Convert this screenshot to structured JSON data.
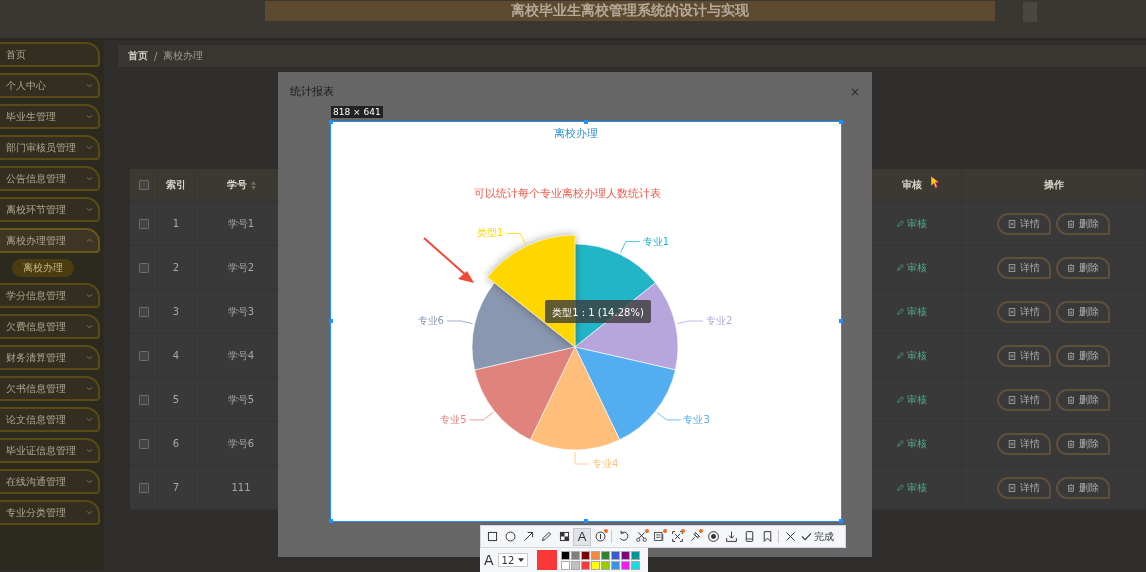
{
  "header": {
    "title": "离校毕业生离校管理系统的设计与实现"
  },
  "sidebar": {
    "items": [
      {
        "label": "首页",
        "has_children": false,
        "expanded": false
      },
      {
        "label": "个人中心",
        "has_children": true,
        "expanded": false
      },
      {
        "label": "毕业生管理",
        "has_children": true,
        "expanded": false
      },
      {
        "label": "部门审核员管理",
        "has_children": true,
        "expanded": false
      },
      {
        "label": "公告信息管理",
        "has_children": true,
        "expanded": false
      },
      {
        "label": "离校环节管理",
        "has_children": true,
        "expanded": false
      },
      {
        "label": "离校办理管理",
        "has_children": true,
        "expanded": true,
        "children": [
          {
            "label": "离校办理",
            "selected": true
          }
        ]
      },
      {
        "label": "学分信息管理",
        "has_children": true,
        "expanded": false
      },
      {
        "label": "欠费信息管理",
        "has_children": true,
        "expanded": false
      },
      {
        "label": "财务清算管理",
        "has_children": true,
        "expanded": false
      },
      {
        "label": "欠书信息管理",
        "has_children": true,
        "expanded": false
      },
      {
        "label": "论文信息管理",
        "has_children": true,
        "expanded": false
      },
      {
        "label": "毕业证信息管理",
        "has_children": true,
        "expanded": false
      },
      {
        "label": "在线沟通管理",
        "has_children": true,
        "expanded": false
      },
      {
        "label": "专业分类管理",
        "has_children": true,
        "expanded": false
      }
    ]
  },
  "breadcrumb": {
    "items": [
      "首页",
      "离校办理"
    ],
    "separator": "/"
  },
  "table": {
    "all_checked": false,
    "columns": [
      "索引",
      "学号",
      "审核",
      "操作"
    ],
    "rows": [
      {
        "checked": false,
        "index": "1",
        "student_id": "学号1",
        "audit": "审核",
        "actions": [
          "详情",
          "删除"
        ]
      },
      {
        "checked": false,
        "index": "2",
        "student_id": "学号2",
        "audit": "审核",
        "actions": [
          "详情",
          "删除"
        ]
      },
      {
        "checked": false,
        "index": "3",
        "student_id": "学号3",
        "audit": "审核",
        "actions": [
          "详情",
          "删除"
        ]
      },
      {
        "checked": false,
        "index": "4",
        "student_id": "学号4",
        "audit": "审核",
        "actions": [
          "详情",
          "删除"
        ]
      },
      {
        "checked": false,
        "index": "5",
        "student_id": "学号5",
        "audit": "审核",
        "actions": [
          "详情",
          "删除"
        ]
      },
      {
        "checked": false,
        "index": "6",
        "student_id": "学号6",
        "audit": "审核",
        "actions": [
          "详情",
          "删除"
        ]
      },
      {
        "checked": false,
        "index": "7",
        "student_id": "111",
        "audit": "审核",
        "actions": [
          "详情",
          "删除"
        ]
      }
    ]
  },
  "dialog": {
    "title": "统计报表",
    "close": "×"
  },
  "capture": {
    "size": "818 × 641",
    "heading": "离校办理",
    "tooltip": "类型1 : 1 (14.28%)",
    "slices": [
      {
        "hovered": false
      },
      {
        "hovered": false
      },
      {
        "hovered": false
      },
      {
        "hovered": false
      },
      {
        "hovered": false
      },
      {
        "hovered": false
      },
      {
        "hovered": true
      }
    ],
    "chart_data": {
      "type": "pie",
      "title": "可以统计每个专业离校办理人数统计表",
      "categories": [
        "专业1",
        "专业2",
        "专业3",
        "专业4",
        "专业5",
        "专业6",
        "类型1"
      ],
      "values": [
        1,
        1,
        1,
        1,
        1,
        1,
        1
      ]
    }
  },
  "toolbar": {
    "tools": [
      {
        "kind": "rect",
        "selected": false,
        "badge": false
      },
      {
        "kind": "ellipse",
        "selected": false,
        "badge": false
      },
      {
        "kind": "arrow",
        "selected": false,
        "badge": false
      },
      {
        "kind": "pencil",
        "selected": false,
        "badge": false
      },
      {
        "kind": "mosaic",
        "selected": false,
        "badge": false
      },
      {
        "kind": "text",
        "glyph": "A",
        "selected": true,
        "badge": false
      },
      {
        "kind": "number",
        "selected": false,
        "badge": true
      },
      {
        "kind": "undo",
        "selected": false,
        "badge": false
      },
      {
        "kind": "scissors",
        "selected": false,
        "badge": true
      },
      {
        "kind": "ocr",
        "selected": false,
        "badge": true
      },
      {
        "kind": "scan",
        "selected": false,
        "badge": true
      },
      {
        "kind": "pin",
        "selected": false,
        "badge": true
      },
      {
        "kind": "record",
        "selected": false,
        "badge": false
      },
      {
        "kind": "download",
        "selected": false,
        "badge": false
      },
      {
        "kind": "phone",
        "selected": false,
        "badge": false
      },
      {
        "kind": "bookmark",
        "selected": false,
        "badge": false
      },
      {
        "kind": "close",
        "selected": false,
        "badge": false
      }
    ],
    "done": "完成",
    "font_glyph": "A",
    "font_size": "12",
    "color": "#fb3838",
    "palette": [
      {
        "color": "#000000"
      },
      {
        "color": "#808080"
      },
      {
        "color": "#800000"
      },
      {
        "color": "#f7883a"
      },
      {
        "color": "#308430"
      },
      {
        "color": "#385ad3"
      },
      {
        "color": "#800080"
      },
      {
        "color": "#009999"
      },
      {
        "color": "#ffffff"
      },
      {
        "color": "#c0c0c0"
      },
      {
        "color": "#fb3838"
      },
      {
        "color": "#ffff00"
      },
      {
        "color": "#99cc00"
      },
      {
        "color": "#3894e4"
      },
      {
        "color": "#f31bf3"
      },
      {
        "color": "#16dcdc"
      }
    ]
  }
}
